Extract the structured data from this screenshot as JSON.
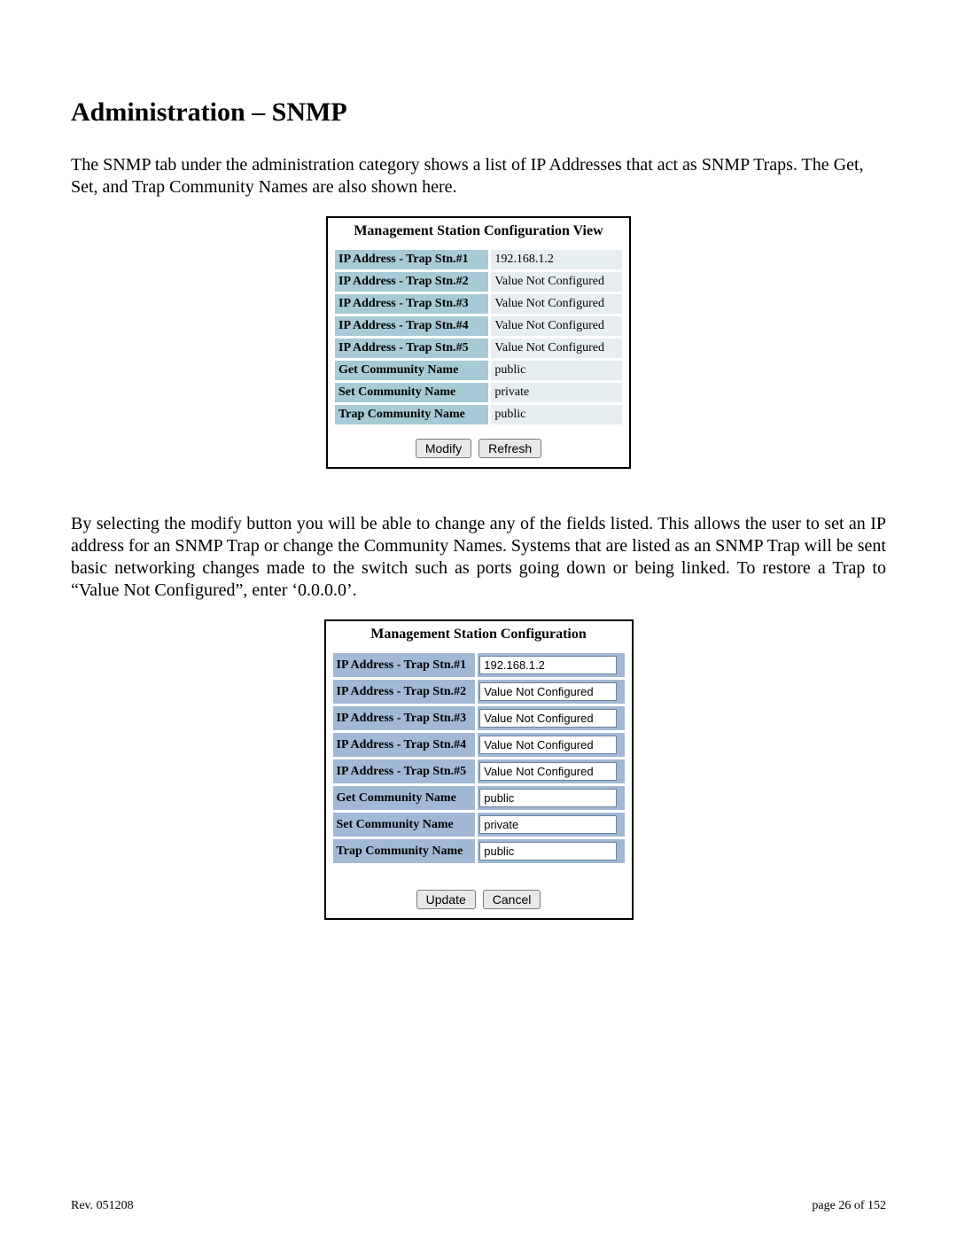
{
  "heading": "Administration – SNMP",
  "intro": "The SNMP tab under the administration category shows a list of IP Addresses that act as SNMP Traps.  The Get, Set, and Trap Community Names are also shown here.",
  "view": {
    "title": "Management Station Configuration View",
    "rows": {
      "r0": {
        "label": "IP Address - Trap Stn.#1",
        "value": "192.168.1.2"
      },
      "r1": {
        "label": "IP Address - Trap Stn.#2",
        "value": "Value Not Configured"
      },
      "r2": {
        "label": "IP Address - Trap Stn.#3",
        "value": "Value Not Configured"
      },
      "r3": {
        "label": "IP Address - Trap Stn.#4",
        "value": "Value Not Configured"
      },
      "r4": {
        "label": "IP Address - Trap Stn.#5",
        "value": "Value Not Configured"
      },
      "r5": {
        "label": "Get Community Name",
        "value": "public"
      },
      "r6": {
        "label": "Set Community Name",
        "value": "private"
      },
      "r7": {
        "label": "Trap Community Name",
        "value": "public"
      }
    },
    "buttons": {
      "modify": "Modify",
      "refresh": "Refresh"
    }
  },
  "para2": "By selecting the modify button you will be able to change any of the fields listed.  This allows the user to set an IP address for an SNMP Trap or change the Community Names.  Systems that are listed as an SNMP Trap will be sent basic networking changes made to the switch such as ports going down or being linked.  To restore a Trap to “Value Not Configured”, enter ‘0.0.0.0’.",
  "edit": {
    "title": "Management Station Configuration",
    "rows": {
      "r0": {
        "label": "IP Address - Trap Stn.#1",
        "value": "192.168.1.2"
      },
      "r1": {
        "label": "IP Address - Trap Stn.#2",
        "value": "Value Not Configured"
      },
      "r2": {
        "label": "IP Address - Trap Stn.#3",
        "value": "Value Not Configured"
      },
      "r3": {
        "label": "IP Address - Trap Stn.#4",
        "value": "Value Not Configured"
      },
      "r4": {
        "label": "IP Address - Trap Stn.#5",
        "value": "Value Not Configured"
      },
      "r5": {
        "label": "Get Community Name",
        "value": "public"
      },
      "r6": {
        "label": "Set Community Name",
        "value": "private"
      },
      "r7": {
        "label": "Trap Community Name",
        "value": "public"
      }
    },
    "buttons": {
      "update": "Update",
      "cancel": "Cancel"
    }
  },
  "footer": {
    "left": "Rev.  051208",
    "right": "page 26 of 152"
  }
}
